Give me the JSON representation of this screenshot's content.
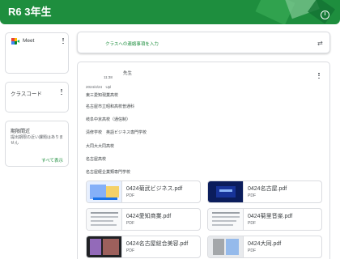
{
  "header": {
    "title": "R6 3年生"
  },
  "sidebar": {
    "meet": {
      "label": "Meet"
    },
    "class_code": {
      "label": "クラスコード"
    },
    "upcoming": {
      "title": "期限間近",
      "text": "提出期限の近い課題はありません",
      "view_all": "すべて表示"
    }
  },
  "composer": {
    "prompt": "クラスへの連絡事項を入力"
  },
  "post": {
    "author": "先生",
    "time": "11:38",
    "date": "2024/4/24　Upl",
    "lines": [
      "東三愛知現業高校",
      "名古屋市立昭和高校普通科",
      "岐阜中京高校（通信制）",
      "清修学校　英語ビジネス専門学校",
      "大同大大同高校",
      "名古屋高校",
      "名古屋経企業類専門学校"
    ],
    "attachments": [
      {
        "name": "0424菊武ビジネス.pdf",
        "type": "PDF"
      },
      {
        "name": "0424名古屋.pdf",
        "type": "PDF"
      },
      {
        "name": "0424愛知商業.pdf",
        "type": "PDF"
      },
      {
        "name": "0424菊里音楽.pdf",
        "type": "PDF"
      },
      {
        "name": "0424名古屋総合美容.pdf",
        "type": "PDF"
      },
      {
        "name": "0424大同.pdf",
        "type": "PDF"
      }
    ]
  },
  "colors": {
    "accent": "#1e8e3e",
    "border": "#dadce0",
    "text": "#3c4043",
    "muted": "#5f6368"
  },
  "icons": {
    "info": "info-icon",
    "meet": "google-meet-icon",
    "more": "more-vert-icon",
    "repost": "repost-icon"
  }
}
